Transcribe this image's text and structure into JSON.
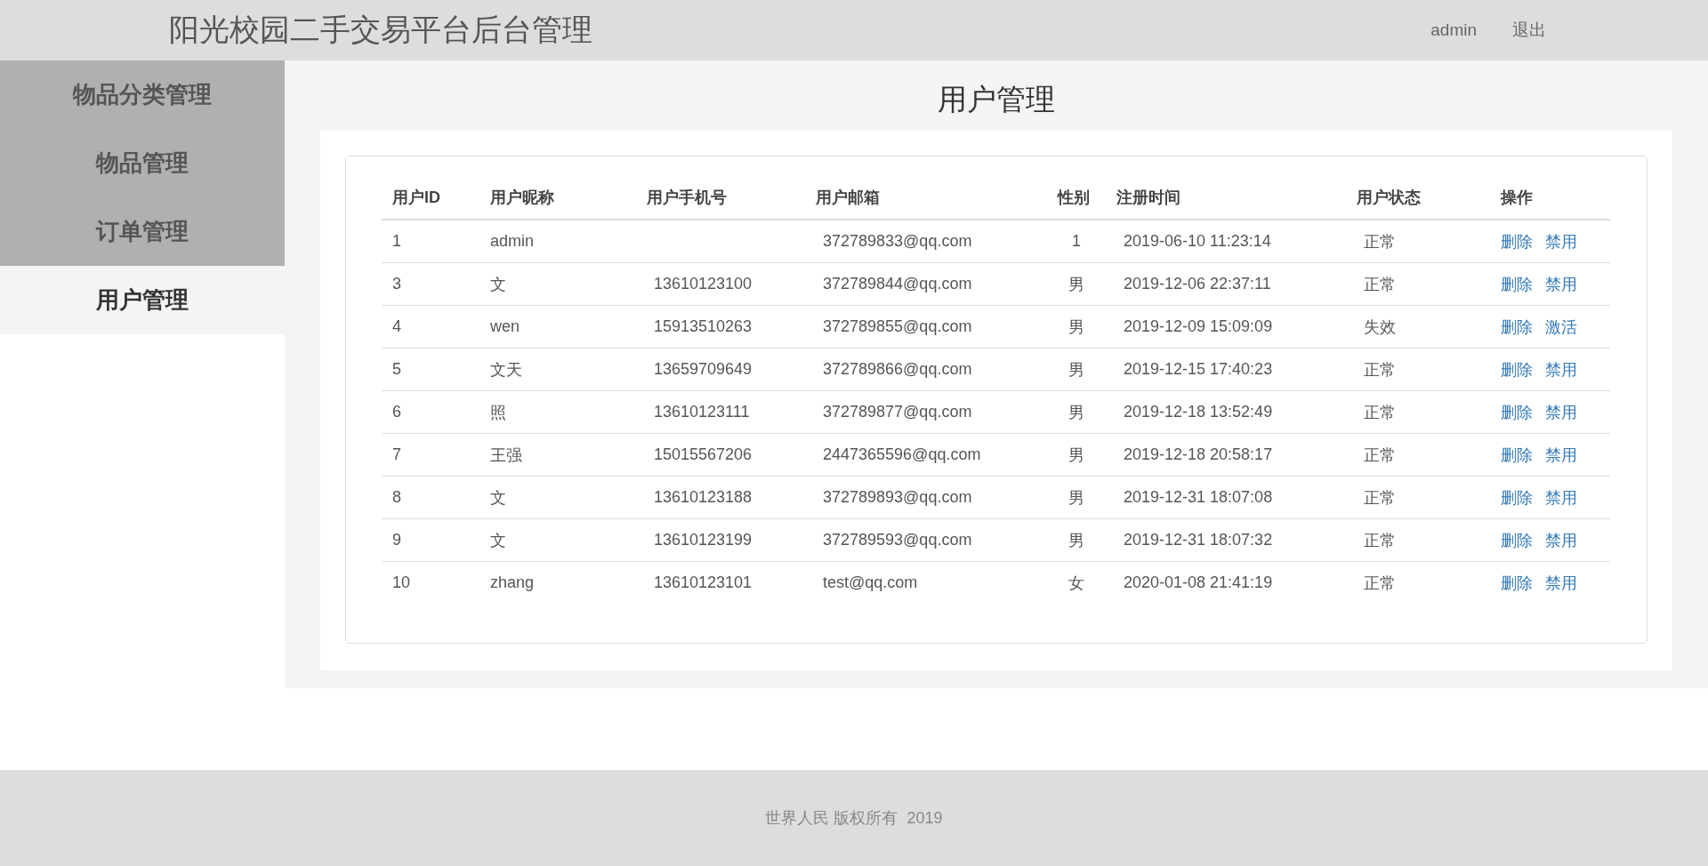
{
  "header": {
    "title": "阳光校园二手交易平台后台管理",
    "user": "admin",
    "logout": "退出"
  },
  "sidebar": {
    "items": [
      {
        "label": "物品分类管理",
        "selected": false
      },
      {
        "label": "物品管理",
        "selected": false
      },
      {
        "label": "订单管理",
        "selected": false
      },
      {
        "label": "用户管理",
        "selected": true
      }
    ]
  },
  "page_title": "用户管理",
  "table": {
    "columns": [
      "用户ID",
      "用户昵称",
      "用户手机号",
      "用户邮箱",
      "性别",
      "注册时间",
      "用户状态",
      "操作"
    ],
    "rows": [
      {
        "id": "1",
        "nickname": "admin",
        "phone": "",
        "email": "372789833@qq.com",
        "gender": "1",
        "registered": "2019-06-10 11:23:14",
        "status": "正常",
        "actions": [
          "删除",
          "禁用"
        ]
      },
      {
        "id": "3",
        "nickname": "文",
        "phone": "13610123100",
        "email": "372789844@qq.com",
        "gender": "男",
        "registered": "2019-12-06 22:37:11",
        "status": "正常",
        "actions": [
          "删除",
          "禁用"
        ]
      },
      {
        "id": "4",
        "nickname": "wen",
        "phone": "15913510263",
        "email": "372789855@qq.com",
        "gender": "男",
        "registered": "2019-12-09 15:09:09",
        "status": "失效",
        "actions": [
          "删除",
          "激活"
        ]
      },
      {
        "id": "5",
        "nickname": "文天",
        "phone": "13659709649",
        "email": "372789866@qq.com",
        "gender": "男",
        "registered": "2019-12-15 17:40:23",
        "status": "正常",
        "actions": [
          "删除",
          "禁用"
        ]
      },
      {
        "id": "6",
        "nickname": "照",
        "phone": "13610123111",
        "email": "372789877@qq.com",
        "gender": "男",
        "registered": "2019-12-18 13:52:49",
        "status": "正常",
        "actions": [
          "删除",
          "禁用"
        ]
      },
      {
        "id": "7",
        "nickname": "王强",
        "phone": "15015567206",
        "email": "2447365596@qq.com",
        "gender": "男",
        "registered": "2019-12-18 20:58:17",
        "status": "正常",
        "actions": [
          "删除",
          "禁用"
        ]
      },
      {
        "id": "8",
        "nickname": "文",
        "phone": "13610123188",
        "email": "372789893@qq.com",
        "gender": "男",
        "registered": "2019-12-31 18:07:08",
        "status": "正常",
        "actions": [
          "删除",
          "禁用"
        ]
      },
      {
        "id": "9",
        "nickname": "文",
        "phone": "13610123199",
        "email": "372789593@qq.com",
        "gender": "男",
        "registered": "2019-12-31 18:07:32",
        "status": "正常",
        "actions": [
          "删除",
          "禁用"
        ]
      },
      {
        "id": "10",
        "nickname": "zhang",
        "phone": "13610123101",
        "email": "test@qq.com",
        "gender": "女",
        "registered": "2020-01-08 21:41:19",
        "status": "正常",
        "actions": [
          "删除",
          "禁用"
        ]
      }
    ]
  },
  "footer": "世界人民 版权所有  2019"
}
